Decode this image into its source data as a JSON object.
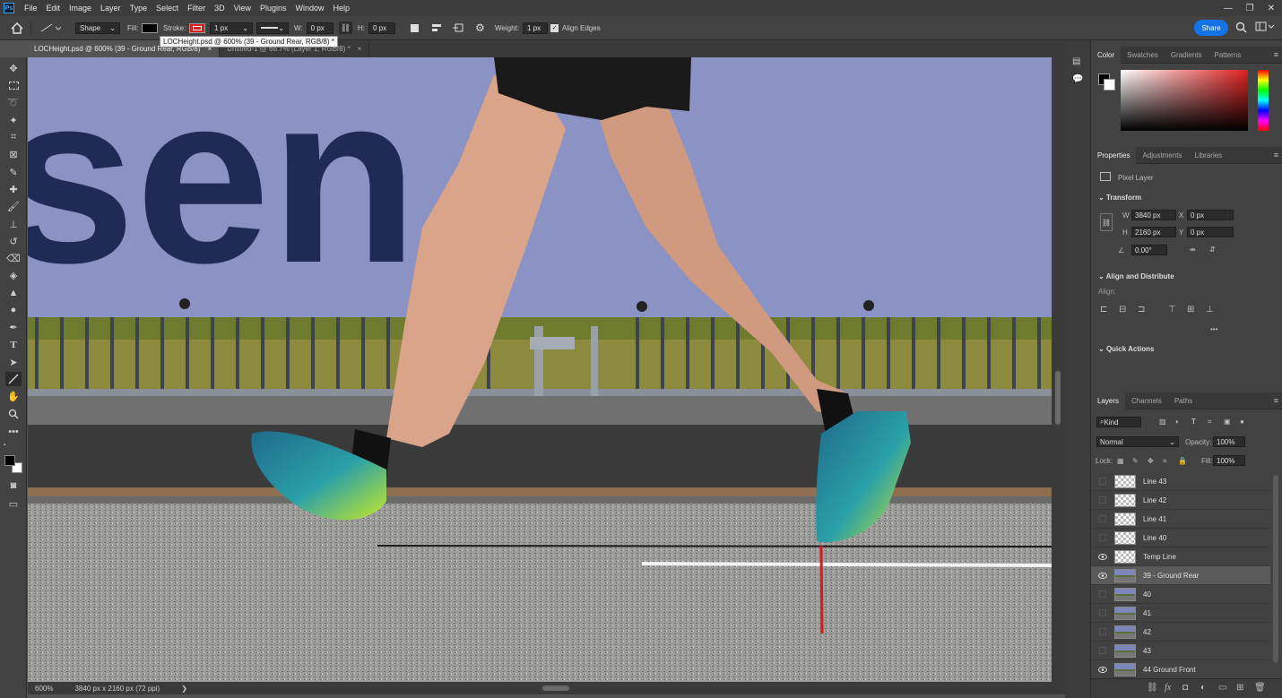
{
  "menu": {
    "logo": "Ps",
    "items": [
      "File",
      "Edit",
      "Image",
      "Layer",
      "Type",
      "Select",
      "Filter",
      "3D",
      "View",
      "Plugins",
      "Window",
      "Help"
    ],
    "window_controls": [
      "—",
      "❐",
      "✕"
    ]
  },
  "options": {
    "mode": "Shape",
    "fill_label": "Fill:",
    "stroke_label": "Stroke:",
    "stroke_width": "1 px",
    "w_label": "W:",
    "w_value": "0 px",
    "h_label": "H:",
    "h_value": "0 px",
    "weight_label": "Weight:",
    "weight_value": "1 px",
    "align_edges": "Align Edges",
    "share": "Share",
    "fill_color": "#000000",
    "stroke_color": "#d62020"
  },
  "tabs": [
    {
      "label": "LOCHeight.psd @ 600% (39 - Ground Rear, RGB/8)",
      "close": "×"
    },
    {
      "label": "Untitled-1 @ 66.7% (Layer 1, RGB/8) *",
      "close": "×"
    }
  ],
  "tooltip": "LOCHeight.psd @ 600% (39 - Ground Rear, RGB/8) *",
  "canvas": {
    "banner_text": "sen"
  },
  "status": {
    "zoom": "600%",
    "size": "3840 px x 2160 px (72 ppi)",
    "arrow": "❯"
  },
  "color_panel": {
    "tabs": [
      "Color",
      "Swatches",
      "Gradients",
      "Patterns"
    ]
  },
  "properties": {
    "tabs": [
      "Properties",
      "Adjustments",
      "Libraries"
    ],
    "layer_type": "Pixel Layer",
    "transform_title": "Transform",
    "w_label": "W",
    "w_value": "3840 px",
    "h_label": "H",
    "h_value": "2160 px",
    "x_label": "X",
    "x_value": "0 px",
    "y_label": "Y",
    "y_value": "0 px",
    "angle_value": "0.00°",
    "align_title": "Align and Distribute",
    "align_label": "Align:",
    "more": "•••",
    "quick_title": "Quick Actions"
  },
  "layers_panel": {
    "tabs": [
      "Layers",
      "Channels",
      "Paths"
    ],
    "kind": "Kind",
    "blend_mode": "Normal",
    "opacity_label": "Opacity:",
    "opacity_value": "100%",
    "lock_label": "Lock:",
    "fill_label": "Fill:",
    "fill_value": "100%",
    "layers": [
      {
        "name": "Line 43",
        "visible": false,
        "thumb": "line"
      },
      {
        "name": "Line 42",
        "visible": false,
        "thumb": "line"
      },
      {
        "name": "Line 41",
        "visible": false,
        "thumb": "line"
      },
      {
        "name": "Line 40",
        "visible": false,
        "thumb": "line"
      },
      {
        "name": "Temp Line",
        "visible": true,
        "thumb": "line"
      },
      {
        "name": "39 - Ground Rear",
        "visible": true,
        "thumb": "photo",
        "selected": true
      },
      {
        "name": "40",
        "visible": false,
        "thumb": "photo"
      },
      {
        "name": "41",
        "visible": false,
        "thumb": "photo"
      },
      {
        "name": "42",
        "visible": false,
        "thumb": "photo"
      },
      {
        "name": "43",
        "visible": false,
        "thumb": "photo"
      },
      {
        "name": "44 Ground Front",
        "visible": true,
        "thumb": "photo"
      }
    ]
  }
}
